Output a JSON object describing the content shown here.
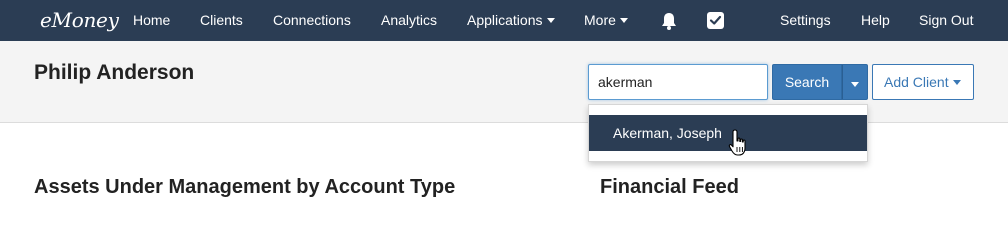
{
  "nav": {
    "logo": "eMoney",
    "items": [
      "Home",
      "Clients",
      "Connections",
      "Analytics",
      "Applications",
      "More"
    ],
    "right_items": [
      "Settings",
      "Help",
      "Sign Out"
    ],
    "icons": [
      "bell-icon",
      "checkbox-icon"
    ]
  },
  "header": {
    "client_name": "Philip Anderson",
    "search_value": "akerman",
    "search_label": "Search",
    "add_client_label": "Add Client"
  },
  "autocomplete": {
    "items": [
      "Akerman, Joseph"
    ]
  },
  "sections": {
    "left_title": "Assets Under Management by Account Type",
    "right_title": "Financial Feed"
  },
  "colors": {
    "nav_bg": "#2b3d54",
    "primary_button": "#3a78b5",
    "header_bg": "#f4f4f4"
  }
}
